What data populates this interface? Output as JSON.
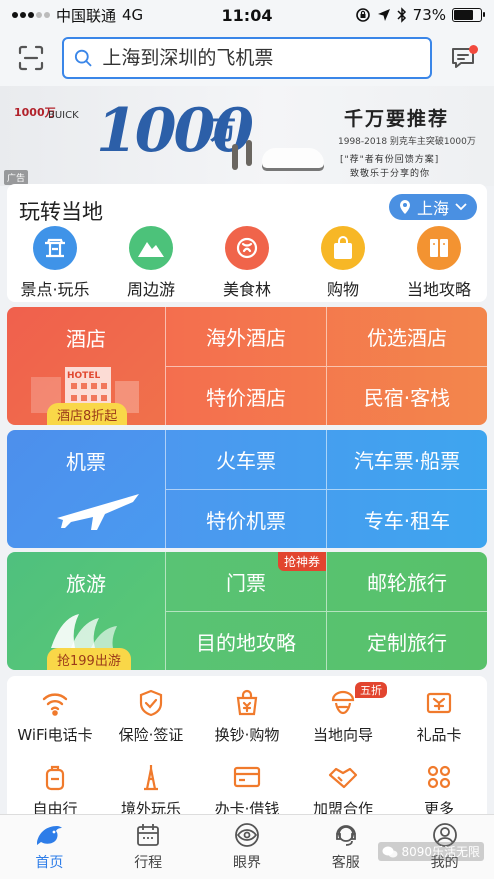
{
  "status_bar": {
    "carrier": "中国联通",
    "network": "4G",
    "time": "11:04",
    "battery": "73%",
    "battery_level": 0.73
  },
  "search": {
    "placeholder": "上海到深圳的飞机票"
  },
  "banner": {
    "brand_1000": "1000万",
    "brand_buick": "BUICK",
    "big_number": "1000",
    "big_unit": "万",
    "headline": "千万要推荐",
    "sub1": "1998-2018 别克车主突破1000万",
    "sub2": "[\"荐\"者有份回馈方案]",
    "sub3": "致敬乐于分享的你",
    "ad_label": "广告"
  },
  "local": {
    "title": "玩转当地",
    "city": "上海",
    "items": [
      {
        "label": "景点·玩乐",
        "icon": "attraction-icon",
        "color": "#3f93e8"
      },
      {
        "label": "周边游",
        "icon": "mountain-icon",
        "color": "#4cc27a"
      },
      {
        "label": "美食林",
        "icon": "food-icon",
        "color": "#f0644a"
      },
      {
        "label": "购物",
        "icon": "shopping-bag-icon",
        "color": "#f7b726"
      },
      {
        "label": "当地攻略",
        "icon": "guide-book-icon",
        "color": "#f39331"
      }
    ]
  },
  "hotel": {
    "main": "酒店",
    "badge": "酒店8折起",
    "sign": "HOTEL",
    "cells": [
      "海外酒店",
      "优选酒店",
      "特价酒店",
      "民宿·客栈"
    ]
  },
  "flight": {
    "main": "机票",
    "cells": [
      "火车票",
      "汽车票·船票",
      "特价机票",
      "专车·租车"
    ]
  },
  "travel": {
    "main": "旅游",
    "badge": "抢199出游",
    "tag": "抢神券",
    "cells": [
      "门票",
      "邮轮旅行",
      "目的地攻略",
      "定制旅行"
    ]
  },
  "services": {
    "sale_badge": "五折",
    "row1": [
      {
        "label": "WiFi电话卡",
        "icon": "wifi-icon"
      },
      {
        "label": "保险·签证",
        "icon": "shield-icon"
      },
      {
        "label": "换钞·购物",
        "icon": "currency-icon"
      },
      {
        "label": "当地向导",
        "icon": "guide-icon"
      },
      {
        "label": "礼品卡",
        "icon": "gift-card-icon"
      }
    ],
    "row2": [
      {
        "label": "自由行",
        "icon": "backpack-icon"
      },
      {
        "label": "境外玩乐",
        "icon": "tower-icon"
      },
      {
        "label": "办卡·借钱",
        "icon": "card-icon"
      },
      {
        "label": "加盟合作",
        "icon": "handshake-icon"
      },
      {
        "label": "更多",
        "icon": "more-icon"
      }
    ]
  },
  "tabs": [
    {
      "label": "首页",
      "icon": "dolphin-home-icon",
      "active": true
    },
    {
      "label": "行程",
      "icon": "calendar-icon",
      "active": false
    },
    {
      "label": "眼界",
      "icon": "eye-icon",
      "active": false
    },
    {
      "label": "客服",
      "icon": "headset-icon",
      "active": false
    },
    {
      "label": "我的",
      "icon": "profile-icon",
      "active": false
    }
  ],
  "watermark": "8090乐活无限",
  "colors": {
    "accent": "#2e7de8",
    "hotel": "#f0644a",
    "flight": "#4a93ec",
    "travel": "#55c274",
    "badge_red": "#e2452f"
  }
}
